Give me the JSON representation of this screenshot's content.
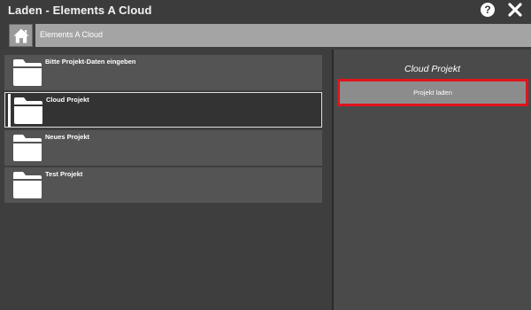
{
  "window": {
    "title": "Laden - Elements A Cloud",
    "help_icon": "help-icon",
    "help_glyph": "?",
    "close_icon": "close-icon"
  },
  "breadcrumb": {
    "home_icon": "home-icon",
    "path": "Elements A Cloud"
  },
  "projects": [
    {
      "label": "Bitte Projekt-Daten eingeben",
      "icon": "folder-icon",
      "selected": false
    },
    {
      "label": "Cloud Projekt",
      "icon": "folder-icon",
      "selected": true
    },
    {
      "label": "Neues Projekt",
      "icon": "folder-icon",
      "selected": false
    },
    {
      "label": "Test Projekt",
      "icon": "folder-icon",
      "selected": false
    }
  ],
  "detail": {
    "title": "Cloud Projekt",
    "load_button": "Projekt laden"
  },
  "colors": {
    "background": "#3a3a3a",
    "item_background": "#545454",
    "selected_background": "#333333",
    "highlight_border": "#e0141c",
    "button_gray": "#8c8c8c"
  }
}
